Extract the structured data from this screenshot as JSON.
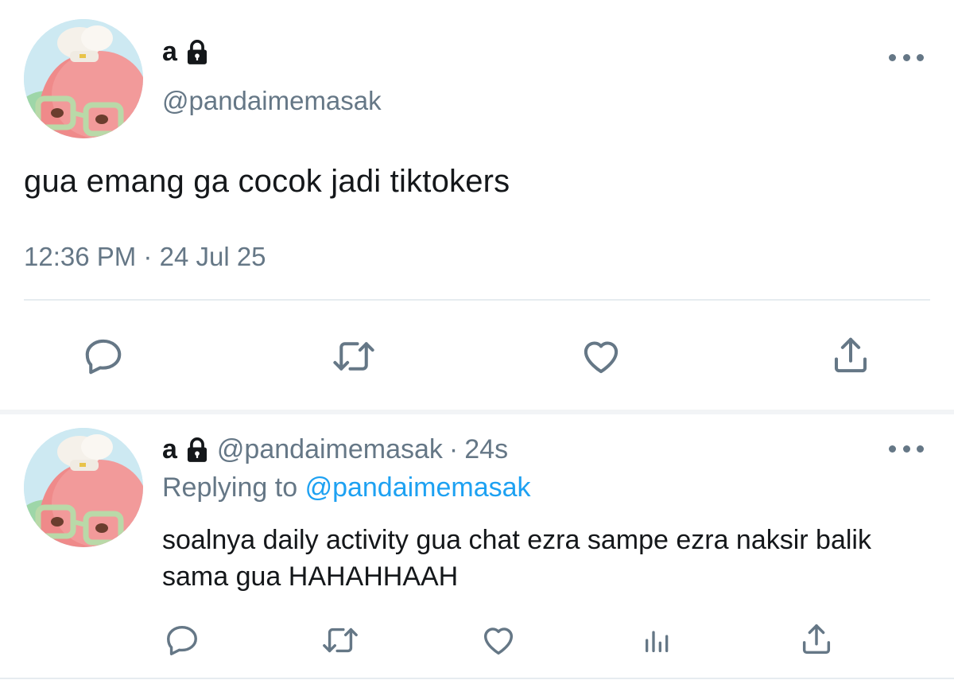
{
  "main_tweet": {
    "display_name": "a",
    "handle": "@pandaimemasak",
    "text": "gua emang ga cocok jadi tiktokers",
    "time": "12:36 PM",
    "separator": "·",
    "date": "24 Jul 25",
    "actions": [
      "reply-icon",
      "retweet-icon",
      "like-icon",
      "share-icon"
    ]
  },
  "reply_tweet": {
    "display_name": "a",
    "handle": "@pandaimemasak",
    "separator": "·",
    "age": "24s",
    "replying_label": "Replying to",
    "replying_to": "@pandaimemasak",
    "text": "soalnya daily activity gua chat ezra sampe ezra naksir balik sama gua HAHAHHAAH",
    "actions": [
      "reply-icon",
      "retweet-icon",
      "like-icon",
      "analytics-icon",
      "share-icon"
    ]
  },
  "colors": {
    "text": "#14171a",
    "secondary": "#657786",
    "link": "#1da1f2",
    "divider": "#e6ecf0"
  }
}
